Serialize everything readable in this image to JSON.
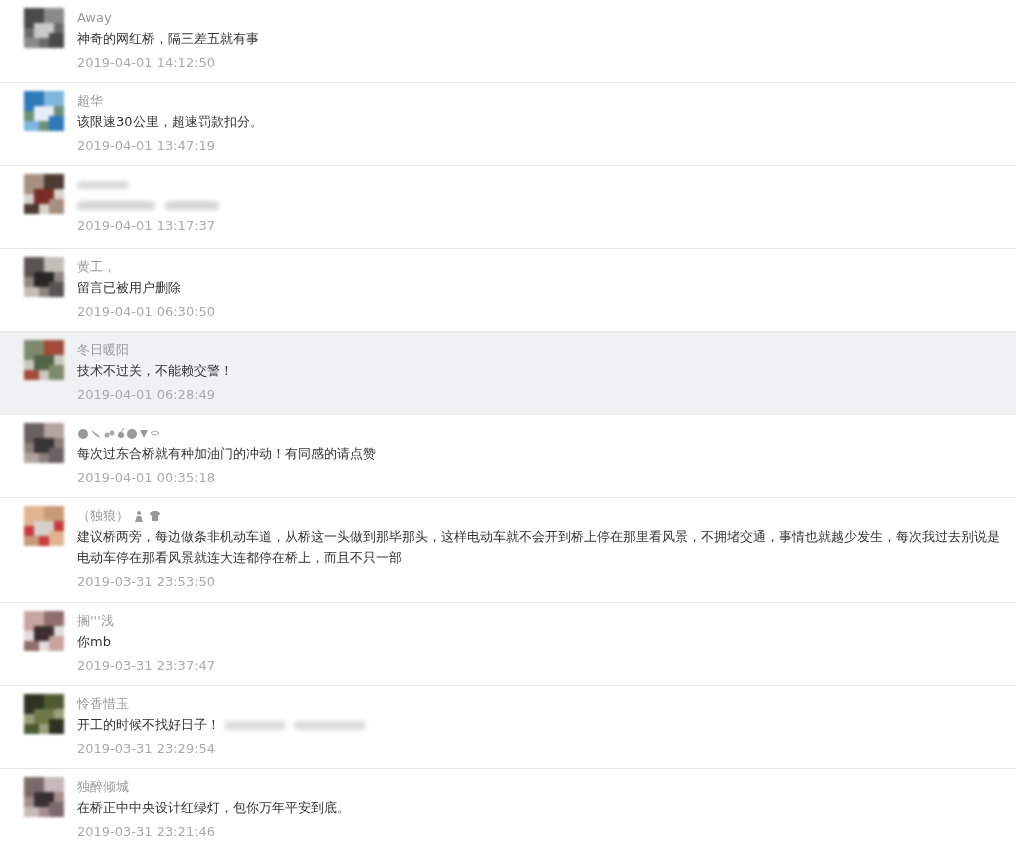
{
  "comments": [
    {
      "kind": "plain",
      "name": "Away",
      "text": "神奇的网红桥，隔三差五就有事",
      "time": "2019-04-01 14:12:50",
      "highlighted": false
    },
    {
      "kind": "plain",
      "name": "超华",
      "text": "该限速30公里，超速罚款扣分。",
      "time": "2019-04-01 13:47:19",
      "highlighted": false
    },
    {
      "kind": "blurred",
      "time": "2019-04-01 13:17:37",
      "highlighted": false
    },
    {
      "kind": "plain",
      "name": "黄工，",
      "text": "留言已被用户删除",
      "time": "2019-04-01 06:30:50",
      "highlighted": false
    },
    {
      "kind": "plain",
      "name": "冬日暖阳",
      "text": "技术不过关，不能赖交警！",
      "time": "2019-04-01 06:28:49",
      "highlighted": true
    },
    {
      "kind": "icons",
      "text": "每次过东合桥就有种加油门的冲动！有同感的请点赞",
      "time": "2019-04-01 00:35:18",
      "highlighted": false
    },
    {
      "kind": "plain",
      "name": "（独狼）",
      "name_icons": true,
      "text": "建议桥两旁，每边做条非机动车道，从桥这一头做到那毕那头，这样电动车就不会开到桥上停在那里看风景，不拥堵交通，事情也就越少发生，每次我过去别说是电动车停在那看风景就连大连都停在桥上，而且不只一部",
      "time": "2019-03-31 23:53:50",
      "highlighted": false
    },
    {
      "kind": "plain",
      "name": "搁'''浅",
      "text": "你mb",
      "time": "2019-03-31 23:37:47",
      "highlighted": false
    },
    {
      "kind": "plain",
      "name": "怜香惜玉",
      "text": "开工的时候不找好日子！",
      "text_tail_blurred": true,
      "time": "2019-03-31 23:29:54",
      "highlighted": false
    },
    {
      "kind": "plain",
      "name": "独醉倾城",
      "text": "在桥正中中央设计红绿灯，包你万年平安到底。",
      "time": "2019-03-31 23:21:46",
      "highlighted": false
    }
  ]
}
